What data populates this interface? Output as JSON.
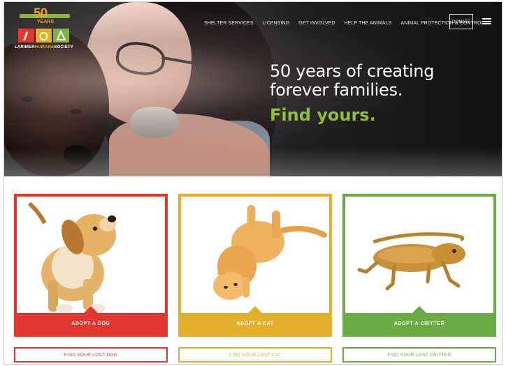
{
  "logo": {
    "fifty": "50",
    "years": "YEARS",
    "org_name_part1": "LARIMER",
    "org_name_part2": "HUMANE",
    "org_name_part3": "SOCIETY",
    "tile_colors": [
      "#e2372f",
      "#e7b024",
      "#7cb342"
    ]
  },
  "nav": {
    "items": [
      {
        "label": "SHELTER SERVICES"
      },
      {
        "label": "LICENSING"
      },
      {
        "label": "GET INVOLVED"
      },
      {
        "label": "HELP THE ANIMALS"
      },
      {
        "label": "ANIMAL PROTECTION & CONTROL"
      }
    ],
    "donate_label": "DONATE",
    "menu_icon": "hamburger-menu-icon"
  },
  "hero": {
    "line1": "50 years of creating",
    "line2": "forever families.",
    "cta": "Find yours."
  },
  "cards": [
    {
      "adopt_label": "ADOPT A DOG",
      "lost_label": "FIND YOUR LOST DOG",
      "color": "#e2372f",
      "animal": "dog"
    },
    {
      "adopt_label": "ADOPT A CAT",
      "lost_label": "FIND YOUR LOST CAT",
      "color": "#e3ae2a",
      "animal": "cat"
    },
    {
      "adopt_label": "ADOPT A CRITTER",
      "lost_label": "FIND YOUR LOST CRITTER",
      "color": "#6aac43",
      "animal": "bearded-dragon"
    }
  ],
  "colors": {
    "accent_green": "#8fbf3b",
    "red": "#e2372f",
    "yellow": "#e3ae2a",
    "green": "#6aac43"
  }
}
